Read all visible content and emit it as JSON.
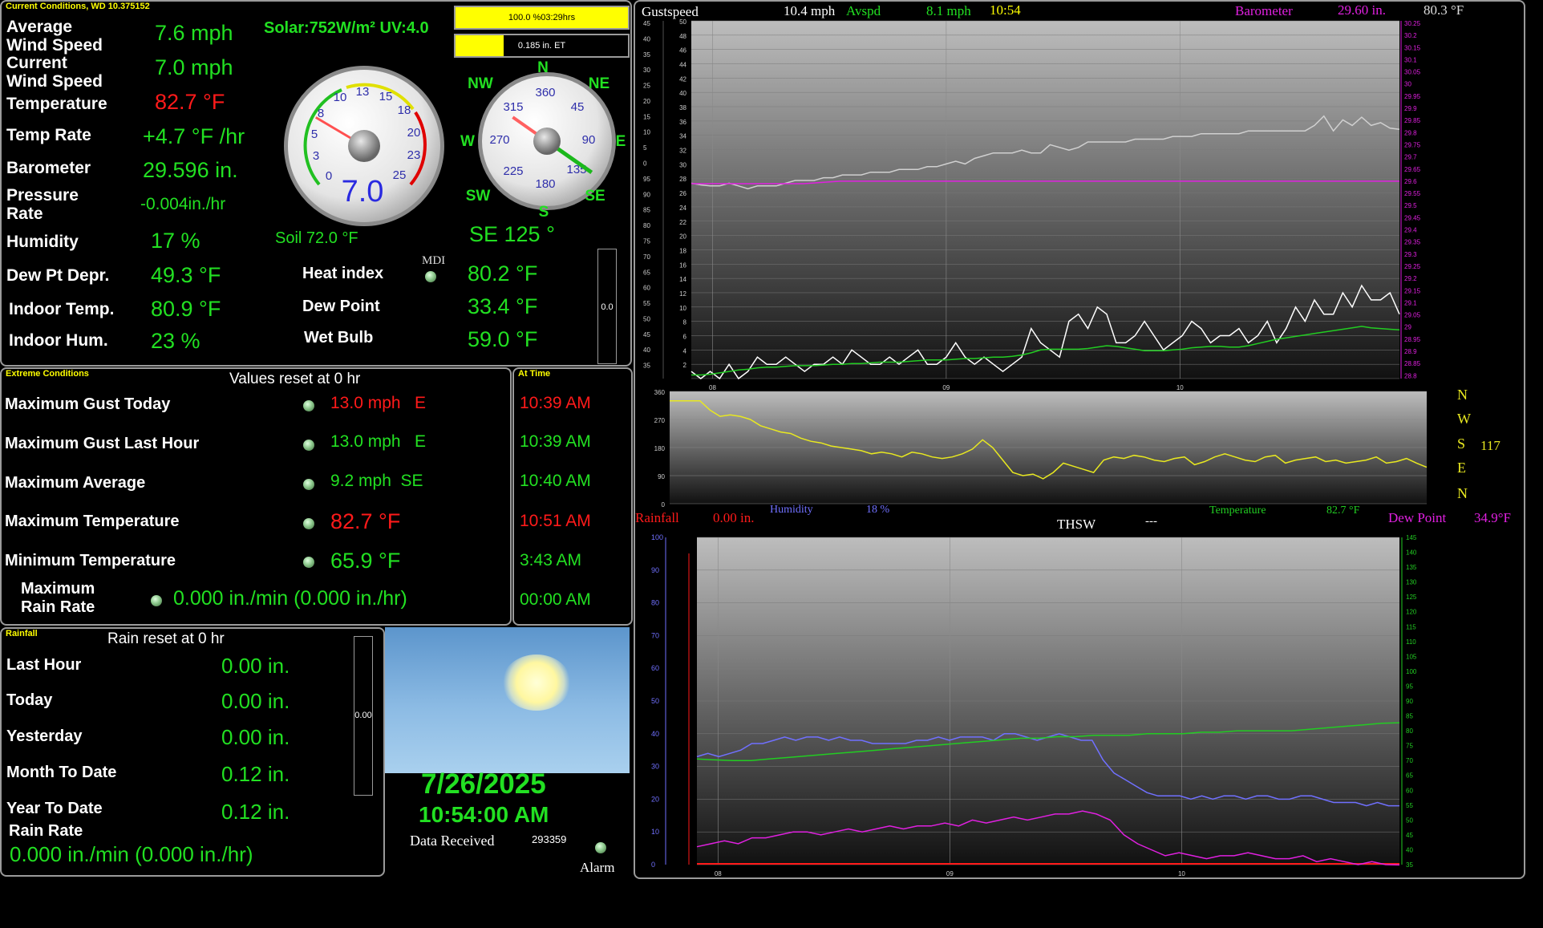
{
  "current": {
    "title": "Current Conditions, WD 10.375152",
    "rows": [
      {
        "label": "Average\nWind Speed",
        "value": "7.6 mph"
      },
      {
        "label": "Current\nWind Speed",
        "value": "7.0 mph"
      },
      {
        "label": "Temperature",
        "value": "82.7 °F"
      },
      {
        "label": "Temp Rate",
        "value": "+4.7 °F /hr"
      },
      {
        "label": "Barometer",
        "value": "29.596 in."
      },
      {
        "label": "Pressure\nRate",
        "value": "-0.004in./hr"
      },
      {
        "label": "Humidity",
        "value": "17 %"
      },
      {
        "label": "Dew Pt Depr.",
        "value": "49.3 °F"
      },
      {
        "label": "Indoor Temp.",
        "value": "80.9 °F"
      },
      {
        "label": "Indoor Hum.",
        "value": "23 %"
      }
    ],
    "solar_uv": "Solar:752W/m² UV:4.0",
    "soil": "Soil  72.0 °F",
    "wind_dir_readout": "SE  125 °",
    "mdi_label": "MDI",
    "heat_index_label": "Heat index",
    "heat_index_value": "80.2 °F",
    "dew_point_label": "Dew Point",
    "dew_point_value": "33.4 °F",
    "wet_bulb_label": "Wet Bulb",
    "wet_bulb_value": "59.0 °F",
    "bar_value": "0.0"
  },
  "solar_bars": {
    "solar_text": "100.0 %03:29hrs",
    "solar_fill": 1.0,
    "et_text": "0.185 in. ET",
    "et_fill": 0.28
  },
  "speed_gauge": {
    "ticks": [
      "0",
      "3",
      "5",
      "8",
      "10",
      "13",
      "15",
      "18",
      "20",
      "23",
      "25"
    ],
    "readout": "7.0",
    "value": 7.0,
    "max": 25
  },
  "compass": {
    "cardinals": {
      "N": "N",
      "NE": "NE",
      "E": "E",
      "SE": "SE",
      "S": "S",
      "SW": "SW",
      "W": "W",
      "NW": "NW"
    },
    "degrees": [
      "360",
      "45",
      "90",
      "135",
      "180",
      "225",
      "270",
      "315"
    ],
    "wind_dir_deg": 125
  },
  "extremes": {
    "title": "Extreme Conditions",
    "reset_note": "Values reset at 0 hr",
    "at_time_title": "At Time",
    "rows": [
      {
        "label": "Maximum Gust Today",
        "value": "13.0 mph   E",
        "time": "10:39 AM",
        "red": true
      },
      {
        "label": "Maximum Gust Last Hour",
        "value": "13.0 mph   E",
        "time": "10:39 AM",
        "red": false
      },
      {
        "label": "Maximum Average",
        "value": "9.2 mph  SE",
        "time": "10:40 AM",
        "red": false
      },
      {
        "label": "Maximum Temperature",
        "value": "82.7 °F",
        "time": "10:51 AM",
        "red": true
      },
      {
        "label": "Minimum Temperature",
        "value": "65.9 °F",
        "time": "3:43 AM",
        "red": false
      },
      {
        "label": "Maximum\nRain Rate",
        "value": "0.000 in./min (0.000 in./hr)",
        "time": "00:00 AM",
        "red": false
      }
    ]
  },
  "rainfall": {
    "title": "Rainfall",
    "reset_note": "Rain reset at 0 hr",
    "rows": [
      {
        "label": "Last Hour",
        "value": "0.00 in."
      },
      {
        "label": "Today",
        "value": "0.00 in."
      },
      {
        "label": "Yesterday",
        "value": "0.00 in."
      },
      {
        "label": "Month To Date",
        "value": "0.12 in."
      },
      {
        "label": "Year To Date",
        "value": "0.12 in."
      }
    ],
    "rain_rate_label": "Rain Rate",
    "rain_rate_value": "0.000 in./min (0.000 in./hr)",
    "bar_value": "0.00"
  },
  "status": {
    "date": "7/26/2025",
    "time": "10:54:00 AM",
    "data_received_label": "Data Received",
    "data_received_count": "293359",
    "alarm_label": "Alarm"
  },
  "graph_header": {
    "gust_label": "Gustspeed",
    "gust_value": "10.4 mph",
    "avg_label": "Avspd",
    "avg_value": "8.1 mph",
    "time": "10:54",
    "baro_label": "Barometer",
    "baro_value": "29.60 in.",
    "temp_value": "80.3 °F"
  },
  "dir_legend": {
    "letters": [
      "N",
      "W",
      "S",
      "E",
      "N"
    ],
    "current_dir": "117"
  },
  "middle_labels": {
    "rainfall_label": "Rainfall",
    "rainfall_value": "0.00 in.",
    "humidity_label": "Humidity",
    "humidity_value": "18 %",
    "thsw_label": "THSW",
    "thsw_value": "---",
    "temperature_label": "Temperature",
    "temperature_value": "82.7 °F",
    "dewpoint_label": "Dew Point",
    "dewpoint_value": "34.9°F"
  },
  "colors": {
    "value_green": "#22e022",
    "alert_red": "#ff1a1a",
    "title_yellow": "#ffff00",
    "baro_magenta": "#e020e0",
    "humidity_blue": "#7070ff",
    "dir_yellow": "#e8e820",
    "chart_bg_top": "#bdbdbd",
    "chart_bg_bottom": "#111111"
  },
  "chart_data": [
    {
      "type": "line",
      "name": "wind and barometer",
      "x_ticks": [
        "08",
        "09",
        "10"
      ],
      "y_left_ticks": [
        "50",
        "48",
        "46",
        "44",
        "42",
        "40",
        "38",
        "36",
        "34",
        "32",
        "30",
        "28",
        "26",
        "24",
        "22",
        "20",
        "18",
        "16",
        "14",
        "12",
        "10",
        "8",
        "6",
        "4",
        "2"
      ],
      "y_left_outer_ticks": [
        "45",
        "40",
        "35",
        "30",
        "25",
        "20",
        "15",
        "10",
        "5",
        "0",
        "95",
        "90",
        "85",
        "80",
        "75",
        "70",
        "65",
        "60",
        "55",
        "50",
        "45",
        "40",
        "35"
      ],
      "y_right_ticks": [
        "30.25",
        "30.2",
        "30.15",
        "30.1",
        "30.05",
        "30",
        "29.95",
        "29.9",
        "29.85",
        "29.8",
        "29.75",
        "29.7",
        "29.65",
        "29.6",
        "29.55",
        "29.5",
        "29.45",
        "29.4",
        "29.35",
        "29.3",
        "29.25",
        "29.2",
        "29.15",
        "29.1",
        "29.05",
        "29",
        "28.95",
        "28.9",
        "28.85",
        "28.8"
      ],
      "series": [
        {
          "name": "Gustspeed",
          "color": "#ffffff",
          "ylim": [
            0,
            50
          ],
          "values": [
            1,
            0,
            1,
            0,
            2,
            0,
            1,
            3,
            2,
            2,
            3,
            2,
            1,
            2,
            2,
            3,
            2,
            4,
            3,
            2,
            2,
            3,
            2,
            3,
            4,
            2,
            2,
            3,
            5,
            3,
            2,
            3,
            2,
            1,
            2,
            3,
            7,
            5,
            4,
            3,
            8,
            9,
            7,
            10,
            9,
            5,
            5,
            6,
            8,
            6,
            4,
            5,
            6,
            8,
            7,
            5,
            6,
            6,
            7,
            5,
            6,
            8,
            5,
            7,
            10,
            8,
            11,
            9,
            9,
            12,
            10,
            13,
            11,
            11,
            12,
            9
          ]
        },
        {
          "name": "Avspd",
          "color": "#22cc22",
          "ylim": [
            0,
            50
          ],
          "values": [
            0.5,
            0.5,
            0.6,
            0.8,
            1,
            1.2,
            1.3,
            1.5,
            1.6,
            1.6,
            1.7,
            1.8,
            1.8,
            1.8,
            1.9,
            2,
            2,
            2.1,
            2.1,
            2.2,
            2.3,
            2.3,
            2.3,
            2.4,
            2.5,
            2.6,
            2.6,
            2.6,
            2.7,
            2.8,
            2.8,
            2.9,
            3,
            3,
            3.1,
            3.3,
            3.6,
            4,
            4.1,
            4.1,
            4.1,
            4.1,
            4.2,
            4.4,
            4.6,
            4.5,
            4.3,
            4.1,
            3.9,
            3.9,
            3.9,
            4,
            4.1,
            4.3,
            4.4,
            4.5,
            4.5,
            4.4,
            4.4,
            4.6,
            4.9,
            5.2,
            5.5,
            5.7,
            5.9,
            6.1,
            6.3,
            6.5,
            6.7,
            6.9,
            7.1,
            7.3,
            7.1,
            7,
            6.9,
            6.8
          ]
        },
        {
          "name": "Temperature",
          "color": "#d0d0d0",
          "ylim": [
            35,
            100
          ],
          "values": [
            70.5,
            70.2,
            70,
            70,
            70.5,
            70,
            69.5,
            70,
            70,
            70,
            70.5,
            71,
            71,
            71,
            71.5,
            71.5,
            72,
            72,
            72,
            72.5,
            72.5,
            72.5,
            73,
            73,
            73,
            73.5,
            73.5,
            74,
            74.5,
            74,
            75,
            75.5,
            76,
            76,
            76,
            76.5,
            76,
            76,
            77.5,
            77,
            76.5,
            77,
            78,
            78,
            78,
            78,
            78,
            78.5,
            78.5,
            78.5,
            78.5,
            79,
            79,
            79,
            79.5,
            79.5,
            79.5,
            79.5,
            79.5,
            80,
            80,
            80,
            80,
            80,
            80,
            80,
            81,
            82.7,
            80,
            82,
            81,
            82.5,
            81,
            81.5,
            80.5,
            80.3
          ]
        },
        {
          "name": "Barometer",
          "color": "#e020e0",
          "ylim": [
            28.8,
            30.25
          ],
          "values": [
            29.59,
            29.59,
            29.59,
            29.59,
            29.6,
            29.6,
            29.6,
            29.6,
            29.6,
            29.6,
            29.6,
            29.6,
            29.6,
            29.6,
            29.6,
            29.6,
            29.6,
            29.6,
            29.6,
            29.6
          ]
        }
      ]
    },
    {
      "type": "line",
      "name": "wind direction",
      "x_ticks": [],
      "y_ticks": [
        "360",
        "270",
        "180",
        "90",
        "0"
      ],
      "ylim": [
        0,
        360
      ],
      "series": [
        {
          "name": "Wind direction",
          "color": "#e8e820",
          "values": [
            330,
            330,
            330,
            330,
            300,
            280,
            285,
            280,
            270,
            250,
            240,
            230,
            225,
            210,
            200,
            195,
            185,
            180,
            175,
            170,
            160,
            165,
            160,
            150,
            165,
            160,
            150,
            145,
            150,
            160,
            175,
            205,
            180,
            140,
            100,
            90,
            95,
            80,
            100,
            130,
            120,
            110,
            100,
            140,
            150,
            145,
            155,
            150,
            140,
            135,
            145,
            150,
            125,
            135,
            150,
            160,
            150,
            140,
            135,
            150,
            155,
            130,
            140,
            145,
            150,
            135,
            140,
            130,
            135,
            140,
            150,
            130,
            135,
            145,
            130,
            117
          ]
        }
      ]
    },
    {
      "type": "line",
      "name": "humidity temperature dew point",
      "x_ticks": [
        "08",
        "09",
        "10"
      ],
      "y_left_ticks": [
        "100",
        "90",
        "80",
        "70",
        "60",
        "50",
        "40",
        "30",
        "20",
        "10",
        "0"
      ],
      "y_right_ticks": [
        "145",
        "140",
        "135",
        "130",
        "125",
        "120",
        "115",
        "110",
        "105",
        "100",
        "95",
        "90",
        "85",
        "80",
        "75",
        "70",
        "65",
        "60",
        "55",
        "50",
        "45",
        "40",
        "35"
      ],
      "series": [
        {
          "name": "Humidity",
          "color": "#7070ff",
          "ylim": [
            0,
            100
          ],
          "values": [
            33,
            34,
            33,
            34,
            35,
            37,
            37,
            38,
            39,
            38,
            39,
            39,
            38,
            39,
            38,
            38,
            37,
            37,
            37,
            37,
            38,
            38,
            39,
            38,
            39,
            39,
            39,
            38,
            40,
            40,
            39,
            38,
            39,
            40,
            39,
            38,
            38,
            32,
            28,
            26,
            24,
            22,
            21,
            21,
            21,
            20,
            21,
            20,
            21,
            21,
            20,
            21,
            21,
            20,
            20,
            21,
            21,
            20,
            19,
            19,
            19,
            18,
            19,
            18,
            18
          ]
        },
        {
          "name": "Temperature",
          "color": "#22cc22",
          "ylim": [
            35,
            145
          ],
          "values": [
            70.5,
            70.2,
            70,
            70,
            70.5,
            71,
            71.5,
            72,
            72.5,
            73,
            73.5,
            74,
            74.5,
            75,
            75.5,
            76,
            76.5,
            77,
            77.5,
            77.5,
            78,
            78,
            78.5,
            78.5,
            78.5,
            79,
            79,
            79,
            79.5,
            79.5,
            80,
            80,
            80,
            80,
            80.5,
            81,
            81.5,
            82,
            82.5,
            82.7
          ]
        },
        {
          "name": "Dew Point",
          "color": "#e020e0",
          "ylim": [
            35,
            145
          ],
          "values": [
            41,
            42,
            43,
            42,
            44,
            44,
            45,
            46,
            46,
            45,
            46,
            47,
            46,
            47,
            48,
            47,
            48,
            48,
            49,
            48,
            50,
            49,
            50,
            51,
            50,
            51,
            52,
            52,
            53,
            52,
            50,
            45,
            42,
            40,
            38,
            39,
            38,
            37,
            38,
            38,
            39,
            38,
            37,
            37,
            38,
            36,
            37,
            36,
            35,
            36,
            35,
            34.9
          ]
        }
      ]
    }
  ]
}
